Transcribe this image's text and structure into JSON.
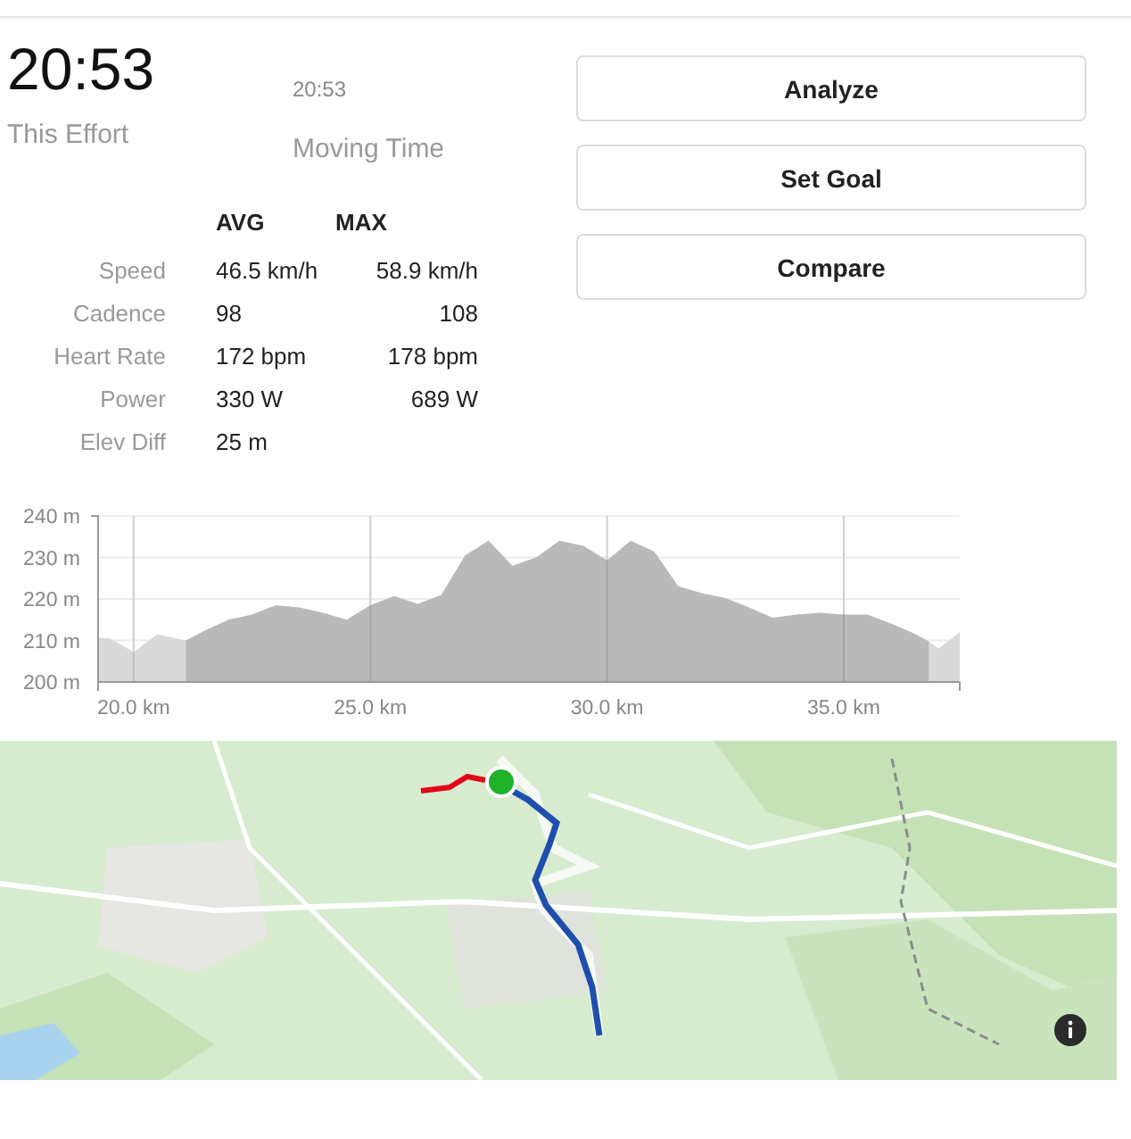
{
  "effort": {
    "time": "20:53",
    "label": "This Effort"
  },
  "moving": {
    "time": "20:53",
    "label": "Moving Time"
  },
  "stats": {
    "columns": [
      "AVG",
      "MAX"
    ],
    "rows": [
      {
        "label": "Speed",
        "avg": "46.5 km/h",
        "max": "58.9 km/h"
      },
      {
        "label": "Cadence",
        "avg": "98",
        "max": "108"
      },
      {
        "label": "Heart Rate",
        "avg": "172 bpm",
        "max": "178 bpm"
      },
      {
        "label": "Power",
        "avg": "330 W",
        "max": "689 W"
      },
      {
        "label": "Elev Diff",
        "avg": "25 m"
      }
    ]
  },
  "buttons": [
    "Analyze",
    "Set Goal",
    "Compare"
  ],
  "elevation": {
    "chart_data": {
      "type": "area",
      "grid": true,
      "xlim": [
        19.25,
        37.45
      ],
      "ylim": [
        200,
        240
      ],
      "x": [
        19.25,
        19.5,
        20,
        20.5,
        21.1,
        21.5,
        22,
        22.5,
        23,
        23.5,
        24,
        24.5,
        25,
        25.5,
        26,
        26.5,
        27,
        27.5,
        28,
        28.5,
        29,
        29.5,
        30,
        30.5,
        31,
        31.5,
        32,
        32.5,
        33,
        33.5,
        34,
        34.5,
        35,
        35.5,
        36,
        36.5,
        36.8,
        37,
        37.45
      ],
      "series": [
        {
          "color": "#d9d9d9",
          "values": [
            210.7,
            210.5,
            207.2,
            211.5,
            210,
            null,
            null,
            null,
            null,
            null,
            null,
            null,
            null,
            null,
            null,
            null,
            null,
            null,
            null,
            null,
            null,
            null,
            null,
            null,
            null,
            null,
            null,
            null,
            null,
            null,
            null,
            null,
            null,
            null,
            null,
            null,
            209.8,
            208,
            212
          ]
        },
        {
          "color": "#b9b9b9",
          "values": [
            null,
            null,
            null,
            null,
            210,
            212.4,
            215,
            216.2,
            218.5,
            218,
            216.7,
            215,
            218.5,
            220.7,
            218.8,
            221,
            230.5,
            234,
            228,
            230,
            234,
            232.8,
            229.3,
            234,
            231.4,
            223.1,
            221.4,
            220.2,
            218,
            215.5,
            216.2,
            216.7,
            216.2,
            216.2,
            214.1,
            211.6,
            209.8,
            null,
            null
          ]
        }
      ],
      "xticks": [
        {
          "value": 20,
          "label": "20.0 km"
        },
        {
          "value": 25,
          "label": "25.0 km"
        },
        {
          "value": 30,
          "label": "30.0 km"
        },
        {
          "value": 35,
          "label": "35.0 km"
        }
      ],
      "yticks": [
        {
          "value": 200,
          "label": "200 m"
        },
        {
          "value": 210,
          "label": "210 m"
        },
        {
          "value": 220,
          "label": "220 m"
        },
        {
          "value": 230,
          "label": "230 m"
        },
        {
          "value": 240,
          "label": "240 m"
        }
      ]
    }
  },
  "map": {
    "kind": "picture"
  }
}
